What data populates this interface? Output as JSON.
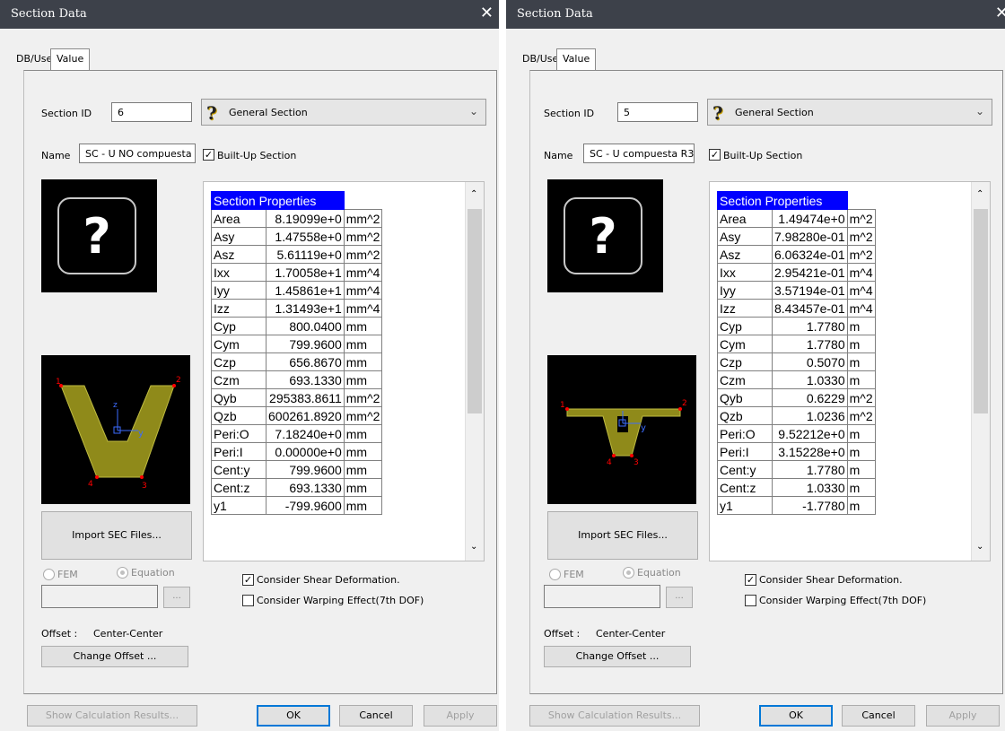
{
  "dialogs": [
    {
      "title": "Section Data",
      "tabs": {
        "db_user": "DB/User",
        "value": "Value"
      },
      "section_id_label": "Section ID",
      "section_id_value": "6",
      "section_type": "General Section",
      "name_label": "Name",
      "name_value": "SC - U NO compuesta",
      "built_up_label": "Built-Up Section",
      "built_up_checked": true,
      "properties_header": "Section Properties",
      "properties": [
        {
          "name": "Area",
          "value": "8.19099e+0",
          "unit": "mm^2"
        },
        {
          "name": "Asy",
          "value": "1.47558e+0",
          "unit": "mm^2"
        },
        {
          "name": "Asz",
          "value": "5.61119e+0",
          "unit": "mm^2"
        },
        {
          "name": "Ixx",
          "value": "1.70058e+1",
          "unit": "mm^4"
        },
        {
          "name": "Iyy",
          "value": "1.45861e+1",
          "unit": "mm^4"
        },
        {
          "name": "Izz",
          "value": "1.31493e+1",
          "unit": "mm^4"
        },
        {
          "name": "Cyp",
          "value": "800.0400",
          "unit": "mm"
        },
        {
          "name": "Cym",
          "value": "799.9600",
          "unit": "mm"
        },
        {
          "name": "Czp",
          "value": "656.8670",
          "unit": "mm"
        },
        {
          "name": "Czm",
          "value": "693.1330",
          "unit": "mm"
        },
        {
          "name": "Qyb",
          "value": "295383.8611",
          "unit": "mm^2"
        },
        {
          "name": "Qzb",
          "value": "600261.8920",
          "unit": "mm^2"
        },
        {
          "name": "Peri:O",
          "value": "7.18240e+0",
          "unit": "mm"
        },
        {
          "name": "Peri:I",
          "value": "0.00000e+0",
          "unit": "mm"
        },
        {
          "name": "Cent:y",
          "value": "799.9600",
          "unit": "mm"
        },
        {
          "name": "Cent:z",
          "value": "693.1330",
          "unit": "mm"
        },
        {
          "name": "y1",
          "value": "-799.9600",
          "unit": "mm"
        }
      ],
      "import_button": "Import SEC Files...",
      "fem_label": "FEM",
      "equation_label": "Equation",
      "browse_label": "...",
      "shear_label": "Consider Shear Deformation.",
      "shear_checked": true,
      "warping_label": "Consider Warping Effect(7th DOF)",
      "warping_checked": false,
      "offset_label": "Offset :",
      "offset_value": "Center-Center",
      "change_offset": "Change Offset ...",
      "show_results": "Show Calculation Results...",
      "ok": "OK",
      "cancel": "Cancel",
      "apply": "Apply",
      "shape": "u-section",
      "node_labels": [
        "1",
        "2",
        "3",
        "4"
      ],
      "axis_labels": {
        "y": "y",
        "z": "z"
      },
      "colors": {
        "section_fill": "#8f8a1a",
        "node": "#ff0000",
        "axis": "#3c6cff",
        "header": "#0000ff"
      }
    },
    {
      "title": "Section Data",
      "tabs": {
        "db_user": "DB/User",
        "value": "Value"
      },
      "section_id_label": "Section ID",
      "section_id_value": "5",
      "section_type": "General Section",
      "name_label": "Name",
      "name_value": "SC - U compuesta R3",
      "built_up_label": "Built-Up Section",
      "built_up_checked": true,
      "properties_header": "Section Properties",
      "properties": [
        {
          "name": "Area",
          "value": "1.49474e+0",
          "unit": "m^2"
        },
        {
          "name": "Asy",
          "value": "7.98280e-01",
          "unit": "m^2"
        },
        {
          "name": "Asz",
          "value": "6.06324e-01",
          "unit": "m^2"
        },
        {
          "name": "Ixx",
          "value": "2.95421e-01",
          "unit": "m^4"
        },
        {
          "name": "Iyy",
          "value": "3.57194e-01",
          "unit": "m^4"
        },
        {
          "name": "Izz",
          "value": "8.43457e-01",
          "unit": "m^4"
        },
        {
          "name": "Cyp",
          "value": "1.7780",
          "unit": "m"
        },
        {
          "name": "Cym",
          "value": "1.7780",
          "unit": "m"
        },
        {
          "name": "Czp",
          "value": "0.5070",
          "unit": "m"
        },
        {
          "name": "Czm",
          "value": "1.0330",
          "unit": "m"
        },
        {
          "name": "Qyb",
          "value": "0.6229",
          "unit": "m^2"
        },
        {
          "name": "Qzb",
          "value": "1.0236",
          "unit": "m^2"
        },
        {
          "name": "Peri:O",
          "value": "9.52212e+0",
          "unit": "m"
        },
        {
          "name": "Peri:I",
          "value": "3.15228e+0",
          "unit": "m"
        },
        {
          "name": "Cent:y",
          "value": "1.7780",
          "unit": "m"
        },
        {
          "name": "Cent:z",
          "value": "1.0330",
          "unit": "m"
        },
        {
          "name": "y1",
          "value": "-1.7780",
          "unit": "m"
        }
      ],
      "import_button": "Import SEC Files...",
      "fem_label": "FEM",
      "equation_label": "Equation",
      "browse_label": "...",
      "shear_label": "Consider Shear Deformation.",
      "shear_checked": true,
      "warping_label": "Consider Warping Effect(7th DOF)",
      "warping_checked": false,
      "offset_label": "Offset :",
      "offset_value": "Center-Center",
      "change_offset": "Change Offset ...",
      "show_results": "Show Calculation Results...",
      "ok": "OK",
      "cancel": "Cancel",
      "apply": "Apply",
      "shape": "u-section-with-flanges",
      "node_labels": [
        "1",
        "2",
        "3",
        "4"
      ],
      "axis_labels": {
        "y": "y",
        "z": "z"
      },
      "colors": {
        "section_fill": "#8f8a1a",
        "node": "#ff0000",
        "axis": "#3c6cff",
        "header": "#0000ff"
      }
    }
  ]
}
